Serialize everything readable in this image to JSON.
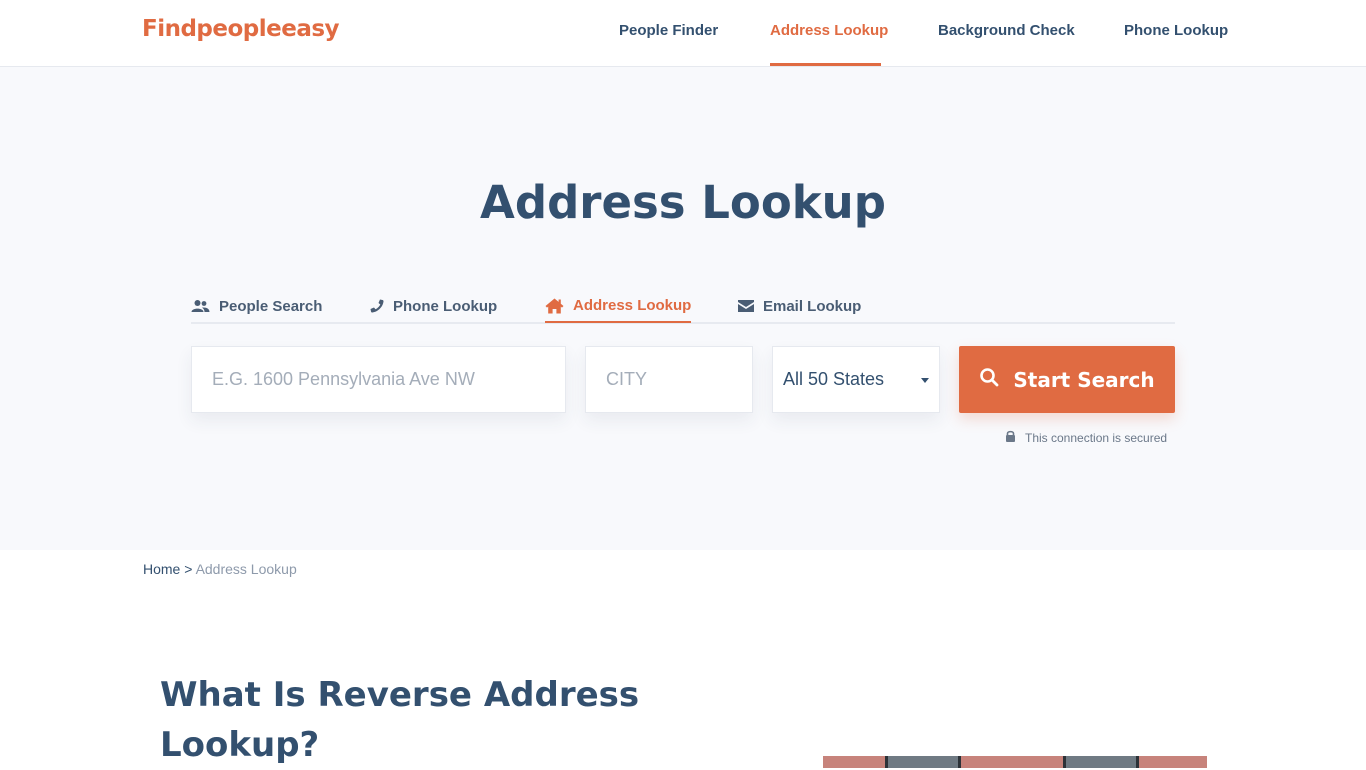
{
  "header": {
    "logo": "Findpeopleeasy",
    "nav": [
      {
        "label": "People Finder",
        "active": false
      },
      {
        "label": "Address Lookup",
        "active": true
      },
      {
        "label": "Background Check",
        "active": false
      },
      {
        "label": "Phone Lookup",
        "active": false
      }
    ]
  },
  "hero": {
    "title": "Address Lookup",
    "tabs": [
      {
        "label": "People Search",
        "icon": "users-icon",
        "active": false
      },
      {
        "label": "Phone Lookup",
        "icon": "phone-icon",
        "active": false
      },
      {
        "label": "Address Lookup",
        "icon": "home-icon",
        "active": true
      },
      {
        "label": "Email Lookup",
        "icon": "envelope-icon",
        "active": false
      }
    ],
    "form": {
      "address_placeholder": "E.G. 1600 Pennsylvania Ave NW",
      "address_value": "",
      "city_placeholder": "CITY",
      "city_value": "",
      "state_selected": "All 50 States",
      "search_button": "Start Search"
    },
    "secure_text": "This connection is secured"
  },
  "breadcrumb": {
    "home": "Home",
    "separator": ">",
    "current": "Address Lookup"
  },
  "section": {
    "title": "What Is Reverse Address Lookup?"
  },
  "colors": {
    "accent": "#e06b42",
    "text": "#33506f",
    "hero_bg": "#f8f9fc"
  }
}
